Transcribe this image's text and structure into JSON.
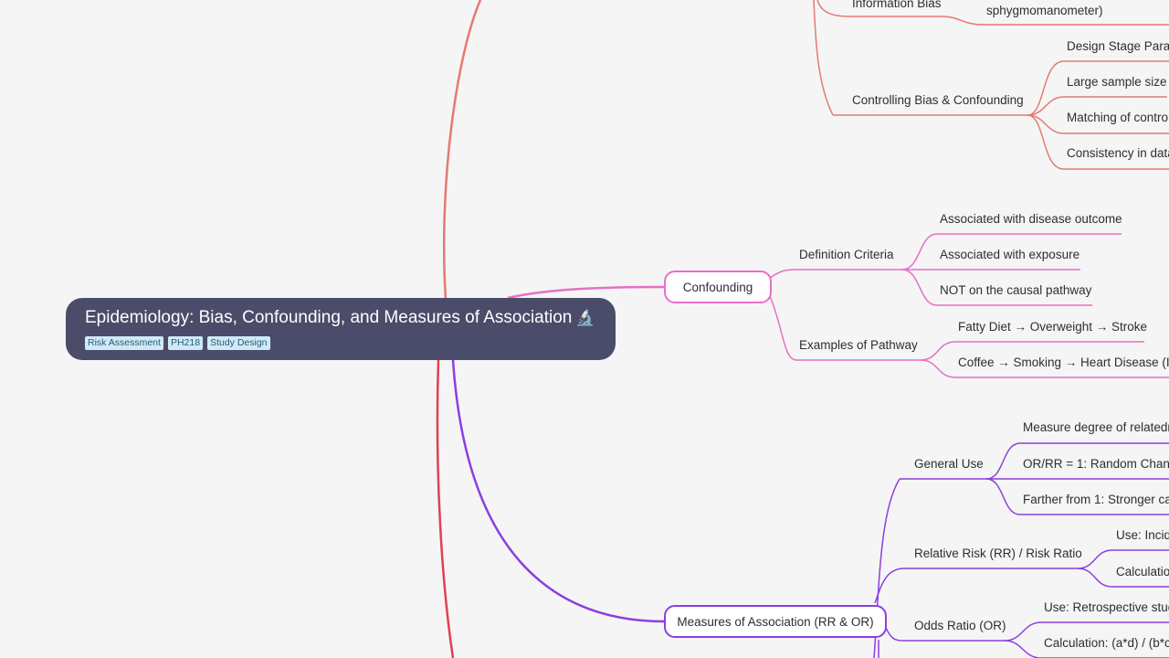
{
  "root": {
    "title": "Epidemiology: Bias, Confounding, and Measures of Association",
    "icon": "🔬",
    "tags": [
      "Risk Assessment",
      "PH218",
      "Study Design"
    ]
  },
  "bias_branch": {
    "color": "#e47a72",
    "information_bias": {
      "label": "Information Bias",
      "child": "sphygmomanometer)"
    },
    "controlling": {
      "label": "Controlling Bias & Confounding",
      "children": [
        "Design Stage Paran",
        "Large sample size",
        "Matching of contro",
        "Consistency in data"
      ]
    }
  },
  "confounding": {
    "label": "Confounding",
    "color": "#e76fc4",
    "definition": {
      "label": "Definition Criteria",
      "children": [
        "Associated with disease outcome",
        "Associated with exposure",
        "NOT on the causal pathway"
      ]
    },
    "examples": {
      "label": "Examples of Pathway",
      "children": [
        "Fatty Diet → Overweight → Stroke",
        "Coffee → Smoking → Heart Disease (Im"
      ]
    }
  },
  "measures": {
    "label": "Measures of Association (RR & OR)",
    "color": "#8b3fe0",
    "general_use": {
      "label": "General Use",
      "children": [
        "Measure degree of relatedn",
        "OR/RR = 1: Random Chance",
        "Farther from 1: Stronger ca"
      ]
    },
    "relative_risk": {
      "label": "Relative Risk (RR) / Risk Ratio",
      "children": [
        "Use: Incid",
        "Calculatio"
      ]
    },
    "odds_ratio": {
      "label": "Odds Ratio (OR)",
      "children": [
        "Use: Retrospective stud",
        "Calculation: (a*d) / (b*c"
      ]
    }
  },
  "lower_branch_color": "#e04152"
}
